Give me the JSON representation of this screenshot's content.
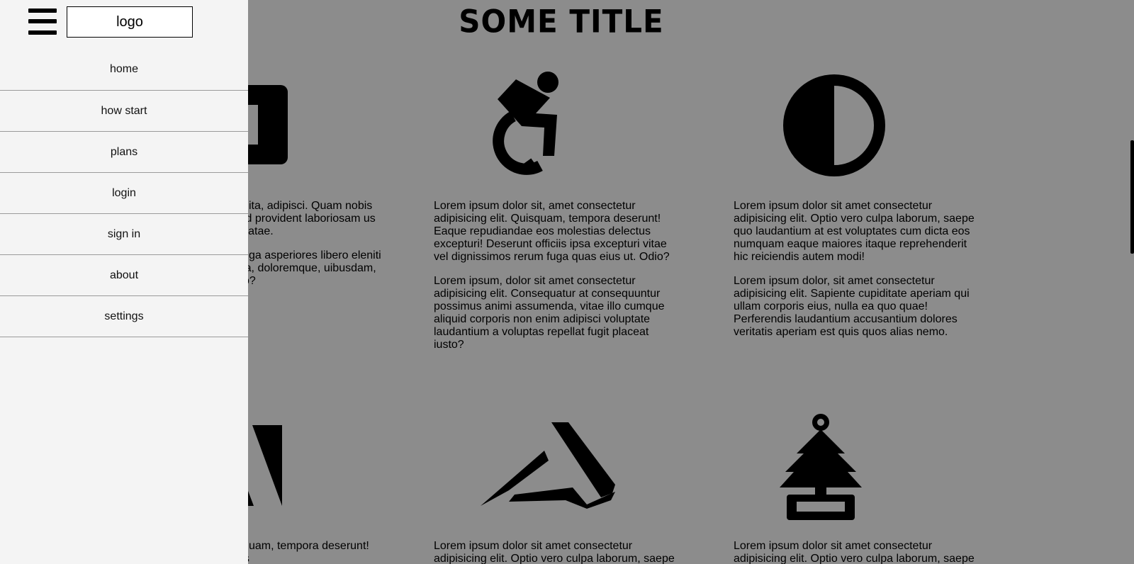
{
  "header": {
    "title": "SOME TITLE"
  },
  "sidebar": {
    "logo": "logo",
    "items": [
      {
        "label": "home"
      },
      {
        "label": "how start"
      },
      {
        "label": "plans"
      },
      {
        "label": "login"
      },
      {
        "label": "sign in"
      },
      {
        "label": "about"
      },
      {
        "label": "settings"
      }
    ]
  },
  "cards": [
    {
      "icon": "document-d-icon",
      "paragraphs": [
        "sit amet, consectetur dita, adipisci. Quam nobis assumenda ullam quod provident laboriosam us doloribus, delectus, beatae.",
        "sit amet consectetur fuga asperiores libero eleniti dolore placeat bus ipsa, doloremque, uibusdam, quos ea eiciendis iusto?"
      ]
    },
    {
      "icon": "accessible-wheelchair-icon",
      "paragraphs": [
        "Lorem ipsum dolor sit, amet consectetur adipisicing elit. Quisquam, tempora deserunt! Eaque repudiandae eos molestias delectus excepturi! Deserunt officiis ipsa excepturi vitae vel dignissimos rerum fuga quas eius ut. Odio?",
        "Lorem ipsum, dolor sit amet consectetur adipisicing elit. Consequatur at consequuntur possimus animi assumenda, vitae illo cumque aliquid corporis non enim adipisci voluptate laudantium a voluptas repellat fugit placeat iusto?"
      ]
    },
    {
      "icon": "contrast-half-circle-icon",
      "paragraphs": [
        "Lorem ipsum dolor sit amet consectetur adipisicing elit. Optio vero culpa laborum, saepe quo laudantium at est voluptates cum dicta eos numquam eaque maiores itaque reprehenderit hic reiciendis autem modi!",
        "Lorem ipsum dolor, sit amet consectetur adipisicing elit. Sapiente cupiditate aperiam qui ullam corporis eius, nulla ea quo quae! Perferendis laudantium accusantium dolores veritatis aperiam est quis quos alias nemo."
      ]
    },
    {
      "icon": "adobe-logo-icon",
      "paragraphs": [
        "sit, amet consectetur quam, tempora deserunt! eos molestias delectus"
      ]
    },
    {
      "icon": "affiliatetheme-icon",
      "paragraphs": [
        "Lorem ipsum dolor sit amet consectetur adipisicing elit. Optio vero culpa laborum, saepe quo laudantium at est voluptates cum"
      ]
    },
    {
      "icon": "air-freshener-icon",
      "paragraphs": [
        "Lorem ipsum dolor sit amet consectetur adipisicing elit. Optio vero culpa laborum, saepe quo laudantium at est voluptates cum"
      ]
    }
  ]
}
